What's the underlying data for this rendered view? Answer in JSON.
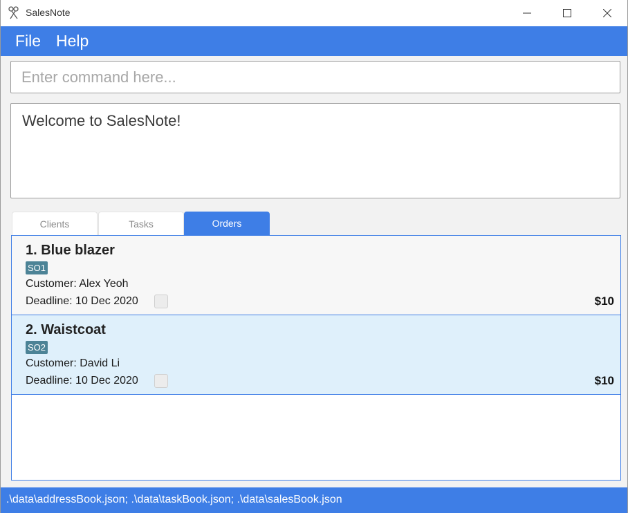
{
  "window": {
    "title": "SalesNote",
    "icon": "scissors-icon",
    "controls": [
      "minimize-icon",
      "maximize-icon",
      "close-icon"
    ]
  },
  "menu": {
    "file": "File",
    "help": "Help"
  },
  "command": {
    "placeholder": "Enter command here...",
    "value": ""
  },
  "result": {
    "text": "Welcome to SalesNote!"
  },
  "tabs": {
    "clients": "Clients",
    "tasks": "Tasks",
    "orders": "Orders",
    "active": "Orders"
  },
  "orders": [
    {
      "title": "1. Blue blazer",
      "tag": "SO1",
      "customer": "Customer:  Alex Yeoh",
      "deadline": "Deadline:  10 Dec 2020",
      "done": false,
      "price": "$10"
    },
    {
      "title": "2. Waistcoat",
      "tag": "SO2",
      "customer": "Customer:  David Li",
      "deadline": "Deadline:  10 Dec 2020",
      "done": false,
      "price": "$10"
    }
  ],
  "status": {
    "text": ".\\data\\addressBook.json; .\\data\\taskBook.json; .\\data\\salesBook.json"
  },
  "colors": {
    "accent": "#3e7ee6",
    "tag": "#4c8396",
    "selected_row": "#dff0fb"
  }
}
